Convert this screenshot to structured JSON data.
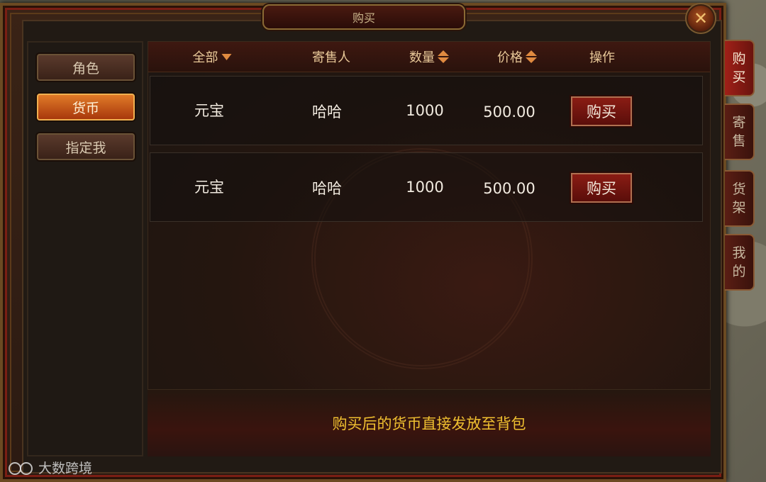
{
  "dialog": {
    "title": "购买",
    "close_glyph": "✕"
  },
  "sidebar": {
    "items": [
      {
        "label": "角色",
        "active": false
      },
      {
        "label": "货币",
        "active": true
      },
      {
        "label": "指定我",
        "active": false
      }
    ]
  },
  "table": {
    "headers": {
      "category": "全部",
      "seller": "寄售人",
      "quantity": "数量",
      "price": "价格",
      "action": "操作"
    },
    "rows": [
      {
        "item": "元宝",
        "seller": "哈哈",
        "quantity": "1000",
        "price": "500.00",
        "action": "购买"
      },
      {
        "item": "元宝",
        "seller": "哈哈",
        "quantity": "1000",
        "price": "500.00",
        "action": "购买"
      }
    ]
  },
  "notice": "购买后的货币直接发放至背包",
  "right_tabs": [
    {
      "line1": "购",
      "line2": "买",
      "active": true
    },
    {
      "line1": "寄",
      "line2": "售",
      "active": false
    },
    {
      "line1": "货",
      "line2": "架",
      "active": false
    },
    {
      "line1": "我",
      "line2": "的",
      "active": false
    }
  ],
  "watermark": "大数跨境",
  "colors": {
    "accent_orange": "#e08a40",
    "notice_yellow": "#f0c030",
    "active_tab_red": "#a02018"
  }
}
